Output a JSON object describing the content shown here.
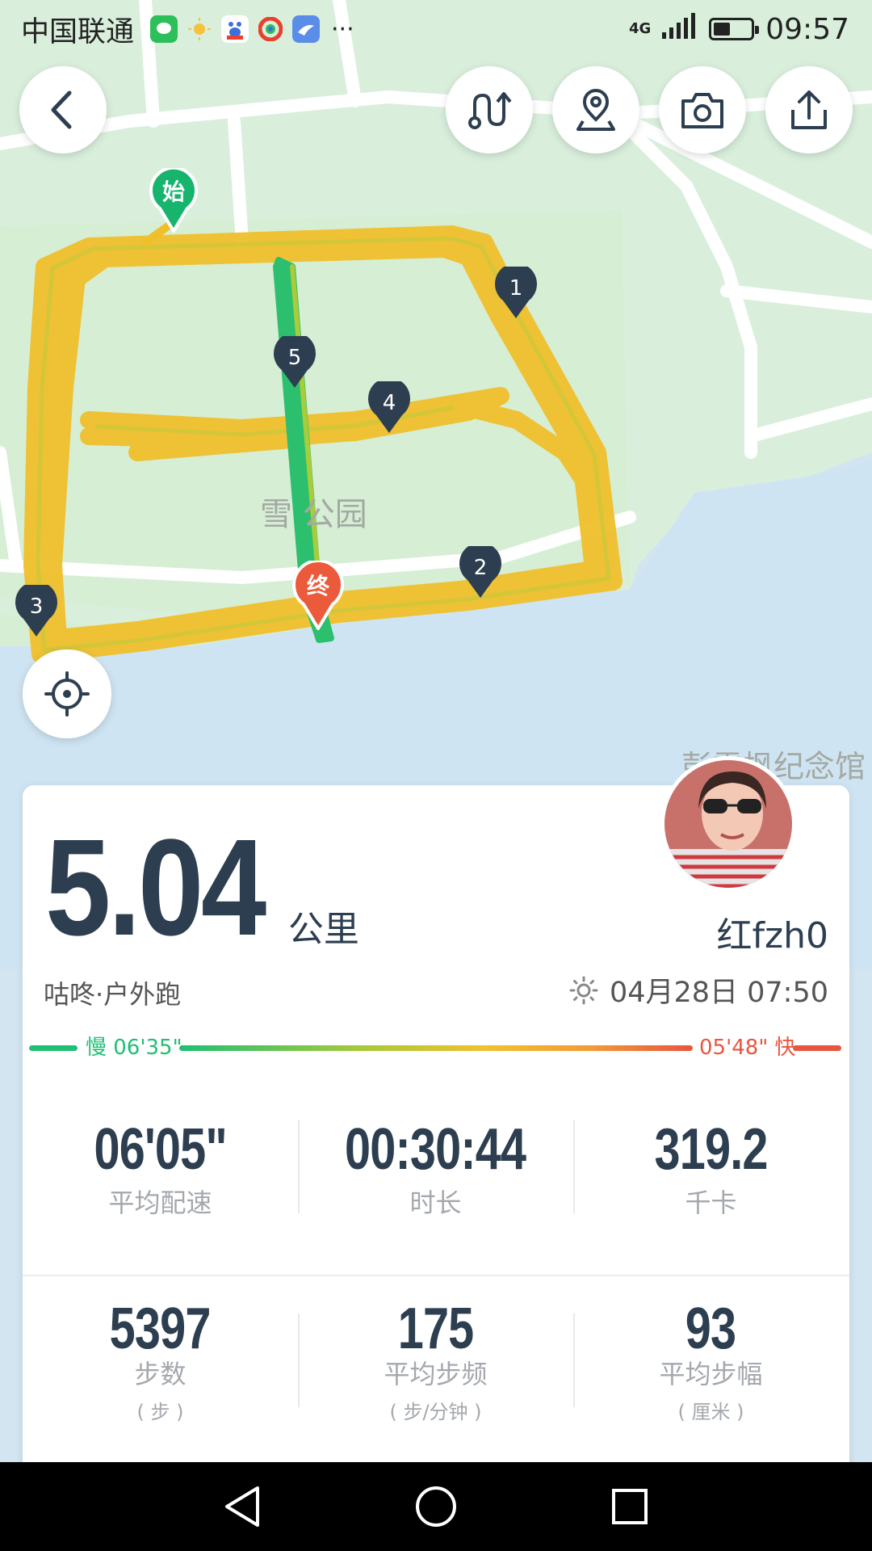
{
  "status_bar": {
    "carrier": "中国联通",
    "network": "4G",
    "time": "09:57",
    "battery_level": 0.45,
    "more": "···"
  },
  "map": {
    "park_label": "雪  公园",
    "memorial_label": "彭雪枫纪念馆",
    "start_label": "始",
    "end_label": "终",
    "km_markers": [
      "1",
      "2",
      "3",
      "4",
      "5"
    ]
  },
  "summary": {
    "distance_value": "5.04",
    "distance_unit": "公里",
    "user_name": "红fzh0",
    "activity_type": "咕咚·户外跑",
    "date_time": "04月28日 07:50"
  },
  "pace_legend": {
    "slow_label": "慢 06'35\"",
    "fast_label": "05'48\" 快",
    "slow_color": "#1fbf74",
    "fast_color": "#e8563f"
  },
  "stats_top": [
    {
      "value": "06'05\"",
      "label": "平均配速"
    },
    {
      "value": "00:30:44",
      "label": "时长"
    },
    {
      "value": "319.2",
      "label": "千卡"
    }
  ],
  "stats_bottom": [
    {
      "value": "5397",
      "label": "步数",
      "unit": "( 步 )"
    },
    {
      "value": "175",
      "label": "平均步频",
      "unit": "( 步/分钟 )"
    },
    {
      "value": "93",
      "label": "平均步幅",
      "unit": "( 厘米 )"
    }
  ],
  "colors": {
    "text_dark": "#2c3e50",
    "route_yellow": "#f0c02c",
    "route_green": "#2cbf6e",
    "map_land": "#d9efdc",
    "map_water": "#cfe4f2"
  }
}
